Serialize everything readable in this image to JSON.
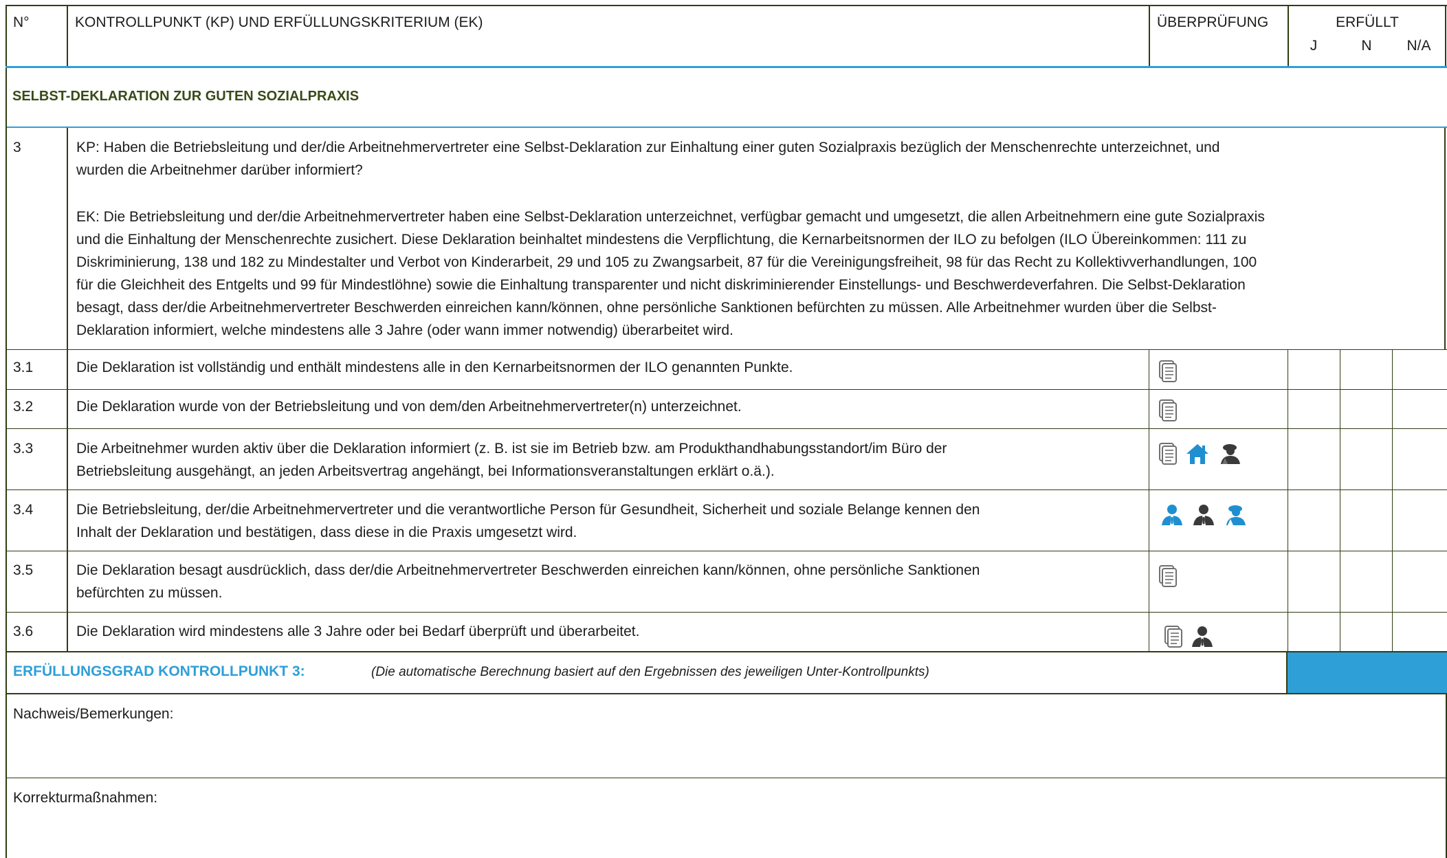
{
  "header": {
    "no": "N°",
    "kp": "KONTROLLPUNKT (KP) UND ERFÜLLUNGSKRITERIUM (EK)",
    "check": "ÜBERPRÜFUNG",
    "fulfilled": "ERFÜLLT",
    "j": "J",
    "n": "N",
    "na": "N/A"
  },
  "section_title": "SELBST-DEKLARATION ZUR GUTEN SOZIALPRAXIS",
  "main_row": {
    "no": "3",
    "kp_line1": "KP: Haben die Betriebsleitung und der/die Arbeitnehmervertreter eine Selbst-Deklaration zur Einhaltung einer guten Sozialpraxis bezüglich der Menschenrechte unterzeichnet, und",
    "kp_line2": "wurden die Arbeitnehmer darüber informiert?",
    "ek_lines": [
      "EK: Die Betriebsleitung und der/die Arbeitnehmervertreter haben eine Selbst-Deklaration unterzeichnet, verfügbar gemacht und umgesetzt, die allen Arbeitnehmern eine gute Sozialpraxis",
      "und die Einhaltung der Menschenrechte zusichert. Diese Deklaration beinhaltet mindestens die Verpflichtung, die Kernarbeitsnormen der ILO zu befolgen (ILO Übereinkommen: 111 zu",
      "Diskriminierung, 138 und 182 zu Mindestalter und Verbot von Kinderarbeit, 29 und 105 zu Zwangsarbeit, 87 für die Vereinigungsfreiheit, 98 für das Recht zu Kollektivverhandlungen, 100",
      "für die Gleichheit des Entgelts und 99 für Mindestlöhne) sowie die Einhaltung transparenter und nicht diskriminierender Einstellungs- und Beschwerdeverfahren. Die Selbst-Deklaration",
      "besagt, dass der/die Arbeitnehmervertreter Beschwerden einreichen kann/können, ohne persönliche Sanktionen befürchten zu müssen. Alle Arbeitnehmer wurden über die Selbst-",
      "Deklaration informiert, welche mindestens alle 3 Jahre (oder wann immer notwendig) überarbeitet wird."
    ]
  },
  "rows": [
    {
      "no": "3.1",
      "lines": [
        "Die Deklaration ist vollständig und enthält mindestens alle in den Kernarbeitsnormen der ILO genannten Punkte."
      ],
      "icons": [
        "document-icon"
      ]
    },
    {
      "no": "3.2",
      "lines": [
        "Die Deklaration wurde von der Betriebsleitung und von dem/den Arbeitnehmervertreter(n) unterzeichnet."
      ],
      "icons": [
        "document-icon"
      ]
    },
    {
      "no": "3.3",
      "lines": [
        "Die Arbeitnehmer wurden aktiv über die Deklaration informiert (z. B. ist sie im Betrieb bzw. am Produkthandhabungsstandort/im Büro der",
        "Betriebsleitung ausgehängt, an jeden Arbeitsvertrag angehängt, bei Informationsveranstaltungen erklärt o.ä.)."
      ],
      "icons": [
        "document-icon",
        "home-icon",
        "worker-interview-icon"
      ]
    },
    {
      "no": "3.4",
      "lines": [
        "Die Betriebsleitung, der/die Arbeitnehmervertreter und die verantwortliche Person für Gesundheit, Sicherheit und soziale Belange kennen den",
        "Inhalt der Deklaration und bestätigen, dass diese in die Praxis umgesetzt wird."
      ],
      "icons": [
        "manager-blue-icon",
        "manager-icon",
        "worker-blue-icon"
      ]
    },
    {
      "no": "3.5",
      "lines": [
        "Die Deklaration besagt ausdrücklich, dass der/die Arbeitnehmervertreter Beschwerden einreichen kann/können, ohne persönliche Sanktionen",
        "befürchten zu müssen."
      ],
      "icons": [
        "document-icon"
      ]
    },
    {
      "no": "3.6",
      "lines": [
        "Die Deklaration wird mindestens alle 3 Jahre oder bei Bedarf überprüft und überarbeitet."
      ],
      "icons": [
        "document-icon",
        "manager-icon"
      ]
    }
  ],
  "summary": {
    "label": "ERFÜLLUNGSGRAD KONTROLLPUNKT 3:",
    "note": "(Die automatische Berechnung basiert auf den Ergebnissen des jeweiligen Unter-Kontrollpunkts)"
  },
  "evidence_label": "Nachweis/Bemerkungen:",
  "corrective_label": "Korrekturmaßnahmen:",
  "colors": {
    "border_olive": "#2f3d12",
    "accent_blue": "#2e9fd7",
    "section_text": "#3a4a16",
    "summary_text": "#2e9fd7",
    "icon_grey": "#6f6f6f"
  }
}
